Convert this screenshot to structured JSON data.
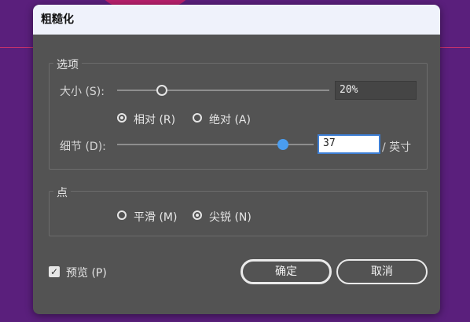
{
  "dialog": {
    "title": "粗糙化",
    "options_group": {
      "label": "选项",
      "size": {
        "label": "大小 (S):",
        "value": "20%",
        "slider_fraction": 0.2
      },
      "mode": {
        "relative_label": "相对 (R)",
        "absolute_label": "绝对 (A)",
        "selected": "relative"
      },
      "detail": {
        "label": "细节 (D):",
        "value": "37",
        "unit": "/ 英寸",
        "slider_fraction": 0.84
      }
    },
    "points_group": {
      "label": "点",
      "smooth_label": "平滑 (M)",
      "corner_label": "尖锐 (N)",
      "selected": "corner"
    },
    "preview": {
      "label": "预览 (P)",
      "checked": true
    },
    "ok_label": "确定",
    "cancel_label": "取消"
  },
  "colors": {
    "background": "#5a1f7c",
    "dialog": "#535353",
    "titlebar": "#eff2fb",
    "accent": "#4a9df0"
  }
}
